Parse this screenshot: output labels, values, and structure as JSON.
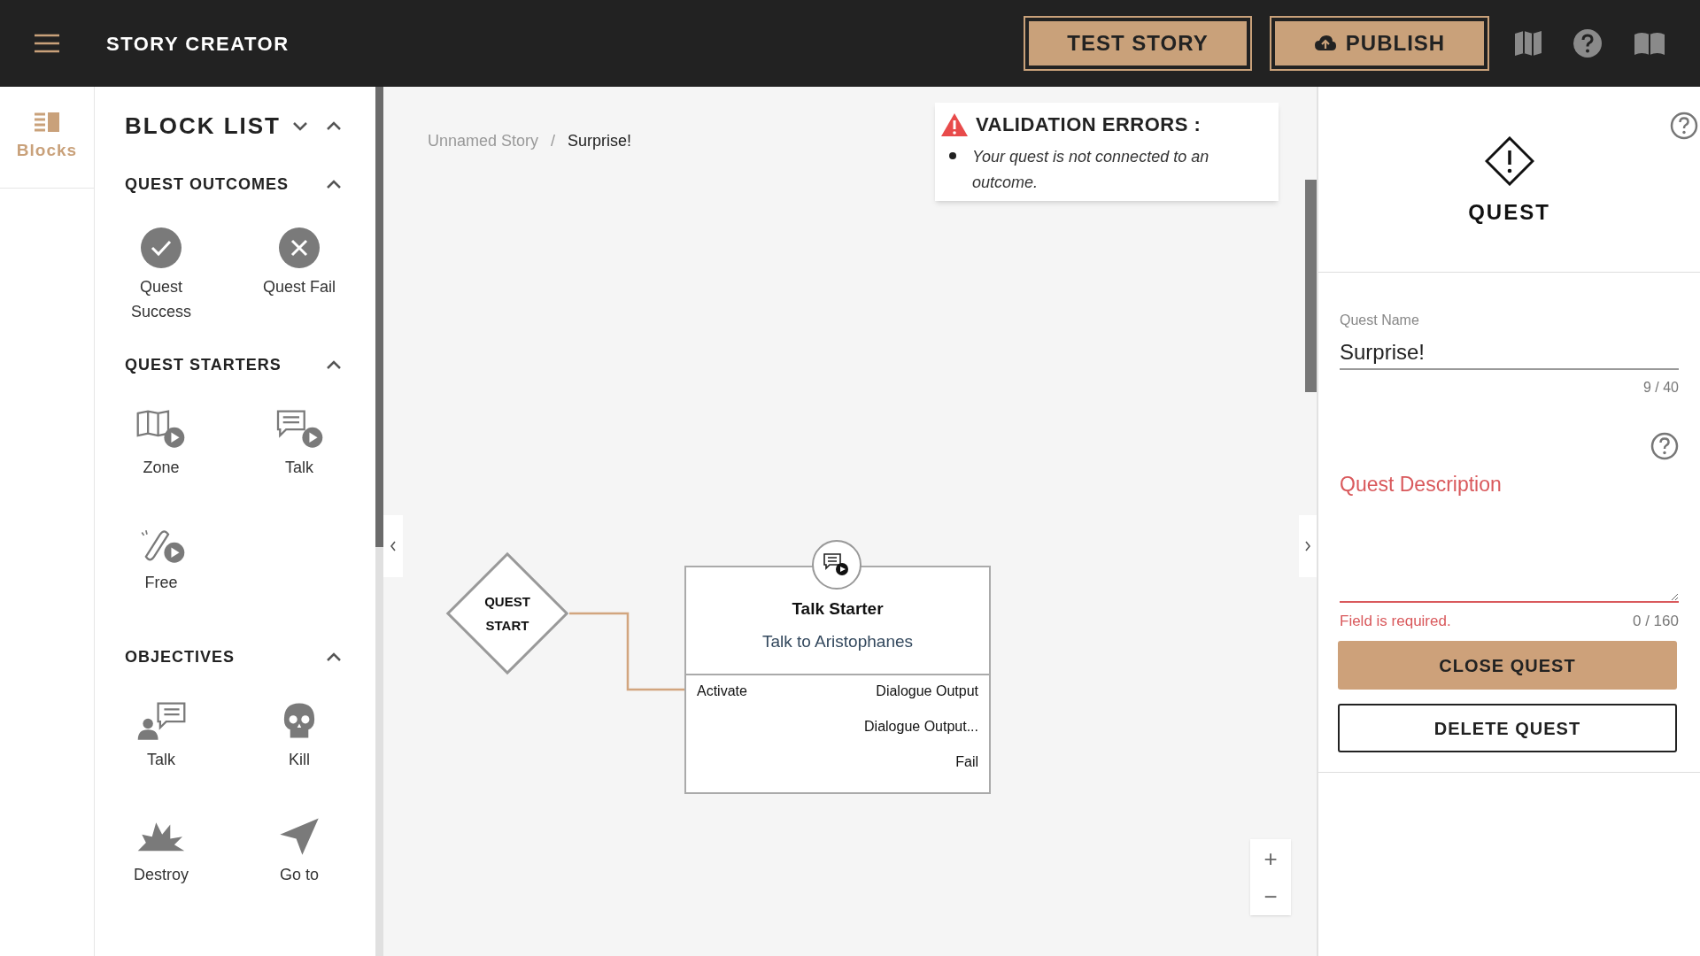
{
  "header": {
    "title": "STORY CREATOR",
    "buttons": [
      {
        "label": "TEST STORY",
        "kind": "plain"
      },
      {
        "label": "PUBLISH",
        "kind": "upload"
      }
    ]
  },
  "rail": {
    "items": [
      {
        "label": "Blocks",
        "selected": true
      }
    ]
  },
  "block_list": {
    "title": "BLOCK LIST",
    "sections": [
      {
        "title": "QUEST OUTCOMES",
        "expanded": true,
        "items": [
          {
            "label": "Quest Success",
            "kind": "success"
          },
          {
            "label": "Quest Fail",
            "kind": "fail"
          }
        ]
      },
      {
        "title": "QUEST STARTERS",
        "expanded": true,
        "items": [
          {
            "label": "Zone",
            "kind": "zone"
          },
          {
            "label": "Talk",
            "kind": "talk-start"
          },
          {
            "label": "Free",
            "kind": "free"
          }
        ]
      },
      {
        "title": "OBJECTIVES",
        "expanded": true,
        "items": [
          {
            "label": "Talk",
            "kind": "talk"
          },
          {
            "label": "Kill",
            "kind": "kill"
          },
          {
            "label": "Destroy",
            "kind": "destroy"
          },
          {
            "label": "Go to",
            "kind": "goto"
          }
        ]
      }
    ]
  },
  "canvas": {
    "breadcrumb": [
      "Unnamed Story",
      "Surprise!"
    ],
    "breadcrumb_separator": "/",
    "validation": {
      "title": "VALIDATION ERRORS :",
      "errors": [
        "Your quest is not connected to an outcome."
      ]
    },
    "nodes": [
      {
        "kind": "start",
        "lines": [
          "QUEST",
          "START"
        ]
      },
      {
        "kind": "talk-starter",
        "title": "Talk Starter",
        "subtitle": "Talk to Aristophanes",
        "inputs": [
          "Activate"
        ],
        "outputs": [
          "Dialogue Output",
          "Dialogue Output...",
          "Fail"
        ]
      }
    ],
    "zoom": [
      "+",
      "−"
    ]
  },
  "quest_panel": {
    "title": "QUEST",
    "name_field": {
      "label": "Quest Name",
      "value": "Surprise!",
      "counter": "9 / 40"
    },
    "description_field": {
      "label": "Quest Description",
      "invalid": true,
      "error": "Field is required.",
      "counter": "0 / 160"
    },
    "buttons": [
      {
        "label": "CLOSE QUEST",
        "kind": "primary"
      },
      {
        "label": "DELETE QUEST",
        "kind": "outline"
      }
    ]
  }
}
